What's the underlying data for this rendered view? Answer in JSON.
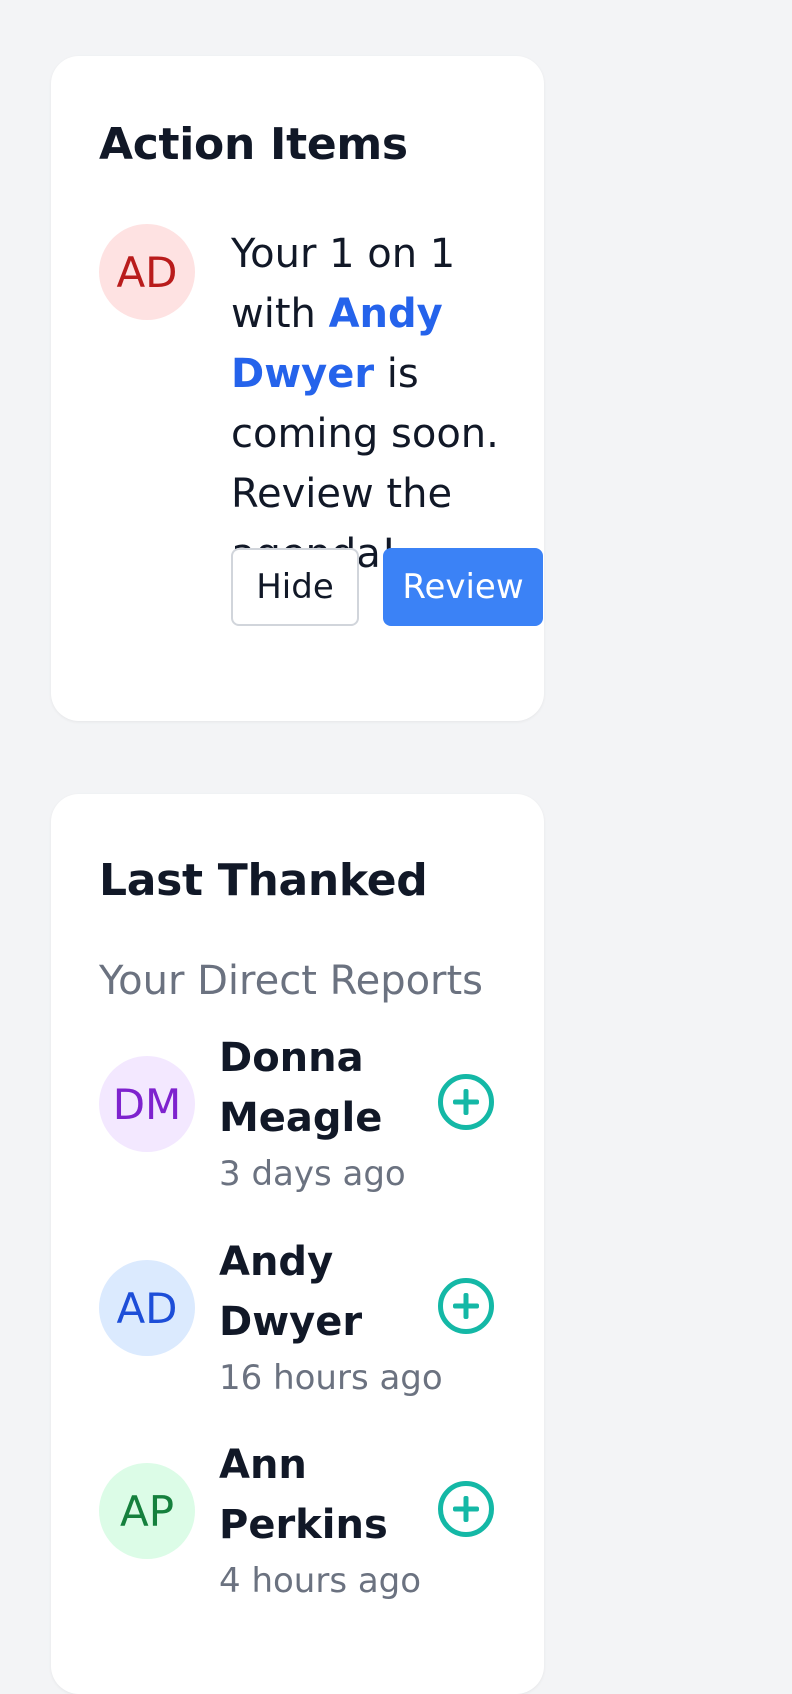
{
  "action_items": {
    "title": "Action Items",
    "item": {
      "avatar_initials": "AD",
      "avatar_colors": {
        "bg": "#fee2e2",
        "fg": "#b91c1c"
      },
      "text_before": "Your 1 on 1 with ",
      "person_link": "Andy Dwyer",
      "text_after": " is coming soon. Review the agenda!",
      "hide_label": "Hide",
      "review_label": "Review"
    }
  },
  "last_thanked": {
    "title": "Last Thanked",
    "subheading": "Your Direct Reports",
    "people": [
      {
        "initials": "DM",
        "name": "Donna Meagle",
        "time": "3 days ago",
        "bg": "#f3e8ff",
        "fg": "#7e22ce",
        "action_icon": "plus-circle-icon"
      },
      {
        "initials": "AD",
        "name": "Andy Dwyer",
        "time": "16 hours ago",
        "bg": "#dbeafe",
        "fg": "#1d4ed8",
        "action_icon": "plus-circle-icon"
      },
      {
        "initials": "AP",
        "name": "Ann Perkins",
        "time": "4 hours ago",
        "bg": "#dcfce7",
        "fg": "#15803d",
        "action_icon": "plus-circle-icon"
      }
    ]
  },
  "colors": {
    "accent": "#3b82f6",
    "link": "#2563eb",
    "add_icon": "#14b8a6",
    "background": "#f3f4f6"
  }
}
